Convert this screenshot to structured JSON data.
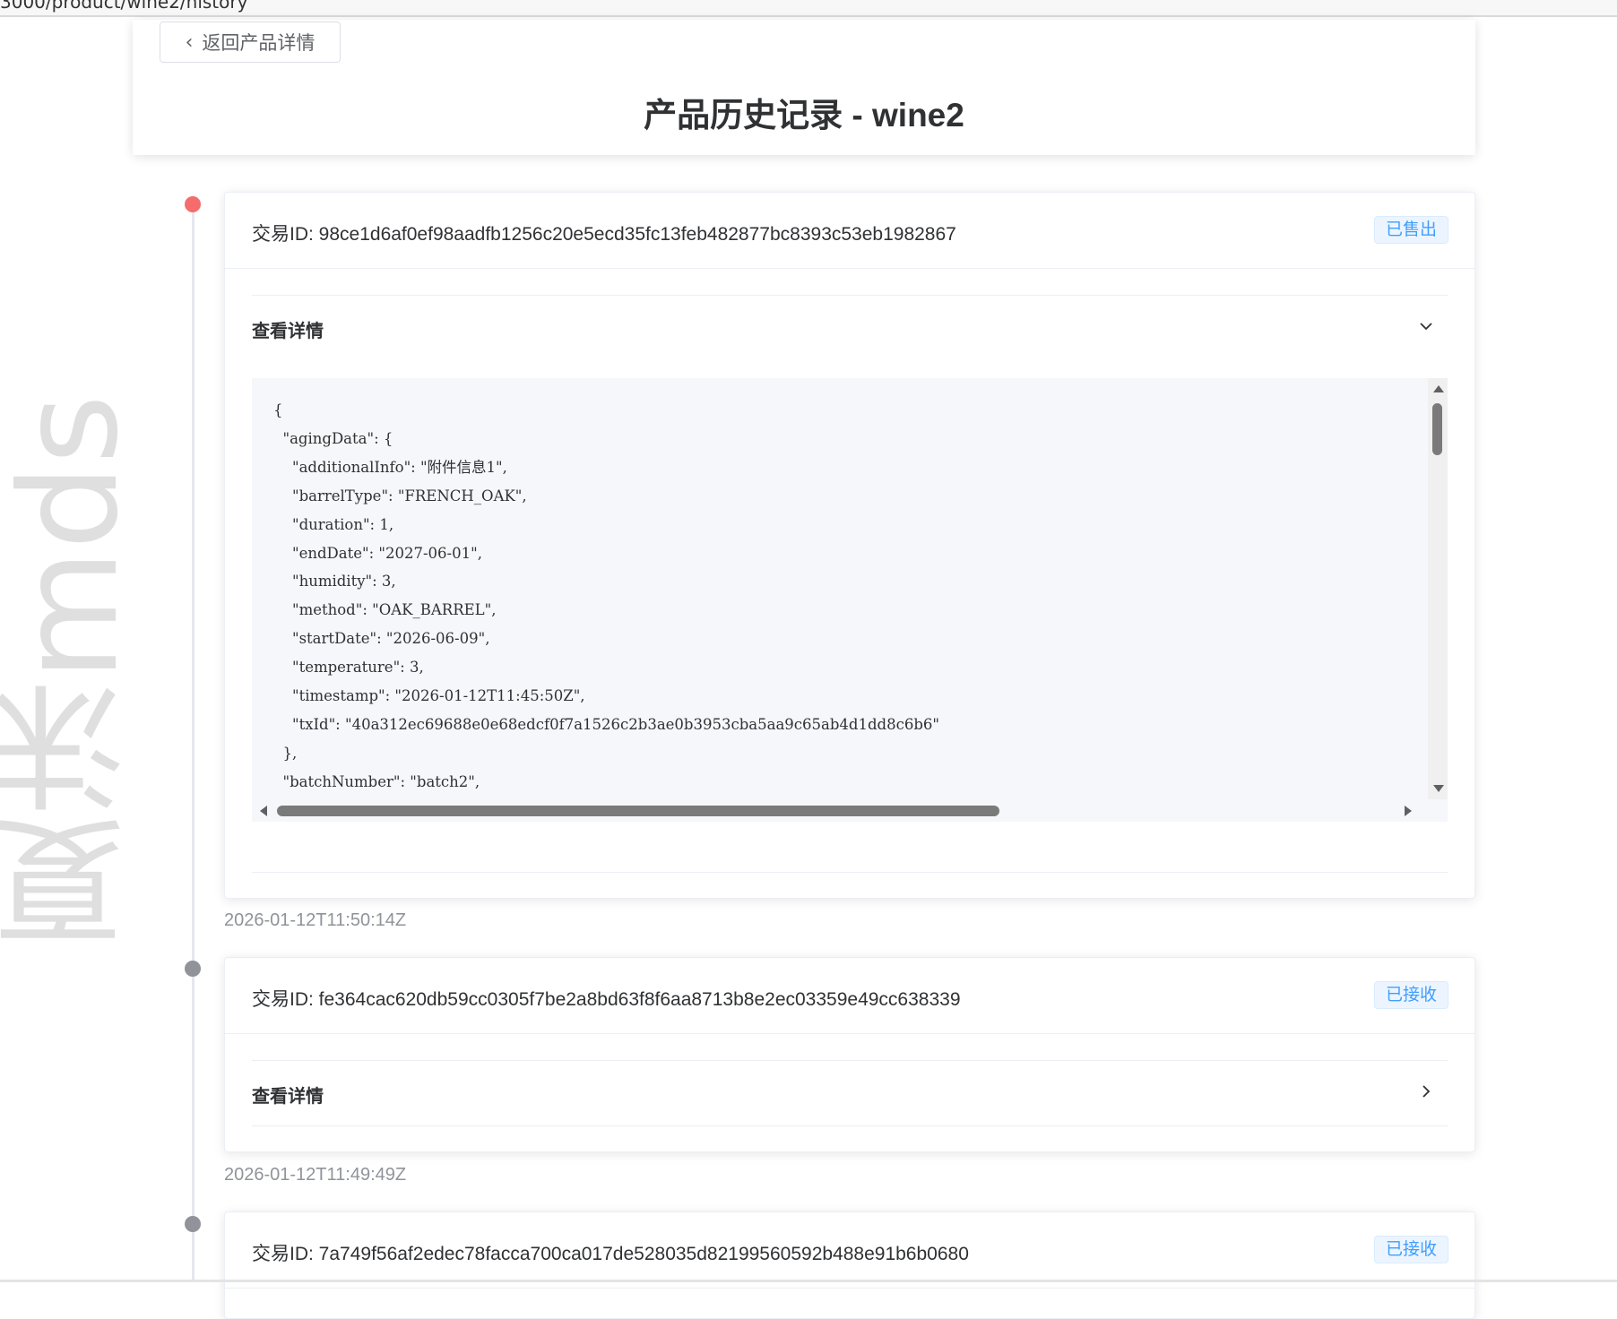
{
  "browser": {
    "url_fragment": "3000/product/wine2/history"
  },
  "watermark": "夏沫mds",
  "header": {
    "back_label": "返回产品详情",
    "title": "产品历史记录 - wine2"
  },
  "records": [
    {
      "txid_label": "交易ID: 98ce1d6af0ef98aadfb1256c20e5ecd35fc13feb482877bc8393c53eb1982867",
      "status": "已售出",
      "details_label": "查看详情",
      "expanded": true,
      "code": "{\n  \"agingData\": {\n    \"additionalInfo\": \"附件信息1\",\n    \"barrelType\": \"FRENCH_OAK\",\n    \"duration\": 1,\n    \"endDate\": \"2027-06-01\",\n    \"humidity\": 3,\n    \"method\": \"OAK_BARREL\",\n    \"startDate\": \"2026-06-09\",\n    \"temperature\": 3,\n    \"timestamp\": \"2026-01-12T11:45:50Z\",\n    \"txId\": \"40a312ec69688e0e68edcf0f7a1526c2b3ae0b3953cba5aa9c65ab4d1dd8c6b6\"\n  },\n  \"batchNumber\": \"batch2\",",
      "timestamp": "2026-01-12T11:50:14Z"
    },
    {
      "txid_label": "交易ID: fe364cac620db59cc0305f7be2a8bd63f8f6aa8713b8e2ec03359e49cc638339",
      "status": "已接收",
      "details_label": "查看详情",
      "expanded": false,
      "timestamp": "2026-01-12T11:49:49Z"
    },
    {
      "txid_label": "交易ID: 7a749f56af2edec78facca700ca017de528035d82199560592b488e91b6b0680",
      "status": "已接收"
    }
  ],
  "colors": {
    "accent": "#409eff",
    "active_dot": "#f56c6c",
    "inactive_dot": "#909399"
  }
}
